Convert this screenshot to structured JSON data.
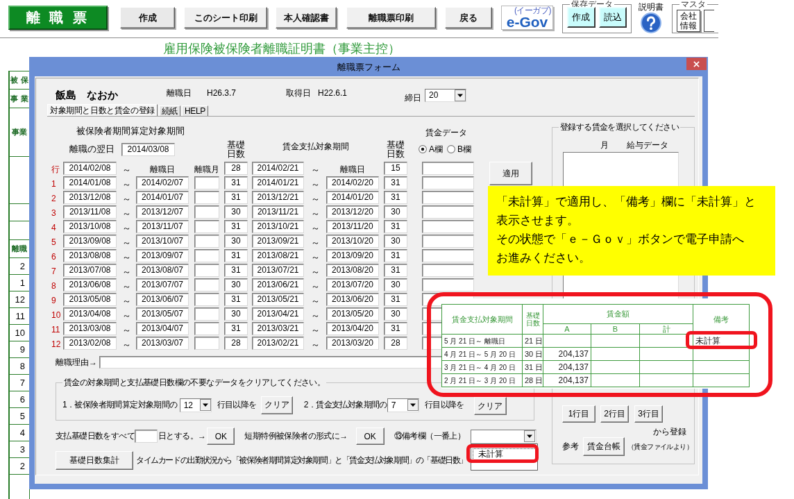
{
  "toolbar": {
    "title_button": "離 職 票",
    "buttons": [
      "作成",
      "このシート印刷",
      "本人確認書",
      "離職票印刷",
      "戻る"
    ],
    "egov": {
      "label": "e-Gov",
      "caption": "(イーガブ)"
    },
    "save_group": {
      "label": "保存データ",
      "buttons": [
        "作成",
        "読込"
      ]
    },
    "manual_label": "説明書",
    "master_group": {
      "label": "マスタ",
      "buttons": [
        "会社情報"
      ]
    }
  },
  "sheet": {
    "title": "雇用保険被保険者離職証明書（事業主控）",
    "side_cells": [
      {
        "kind": "label",
        "text": "被 保"
      },
      {
        "kind": "label",
        "text": "事 業"
      },
      {
        "kind": "label",
        "text": "事業"
      },
      {
        "kind": "blank"
      },
      {
        "kind": "blank"
      },
      {
        "kind": "blank"
      },
      {
        "kind": "label",
        "text": "離職"
      },
      {
        "kind": "month",
        "text": "2"
      },
      {
        "kind": "month",
        "text": "1"
      },
      {
        "kind": "month",
        "text": "12"
      },
      {
        "kind": "month",
        "text": "11"
      },
      {
        "kind": "month",
        "text": "10"
      },
      {
        "kind": "month",
        "text": "9"
      },
      {
        "kind": "month",
        "text": "8"
      },
      {
        "kind": "month",
        "text": "7"
      },
      {
        "kind": "month",
        "text": "6"
      },
      {
        "kind": "month",
        "text": "5"
      },
      {
        "kind": "month",
        "text": "4"
      },
      {
        "kind": "month",
        "text": "3"
      },
      {
        "kind": "month",
        "text": "2"
      },
      {
        "kind": "blank"
      }
    ]
  },
  "dialog": {
    "title": "離職票フォーム",
    "employee": {
      "name": "飯島　なおか",
      "separation_label": "離職日",
      "separation_date": "H26.3.7",
      "acquired_label": "取得日",
      "acquired_date": "H22.6.1",
      "closing_label": "締日",
      "closing_day": "20"
    },
    "tabs": [
      {
        "label": "対象期間と日数と賃金の登録",
        "selected": true
      },
      {
        "label": "続紙",
        "selected": false
      },
      {
        "label": "HELP",
        "selected": false
      }
    ],
    "period_header": {
      "insured_title": "被保険者期間算定対象期間",
      "next_day_label": "離職の翌日",
      "next_day": "2014/03/08",
      "insured_days_label": "基礎日数",
      "wage_title": "賃金支払対象期間",
      "wage_days_label": "基礎日数",
      "wage_data_label": "賃金データ",
      "wage_columns": [
        {
          "label": "A欄",
          "selected": true
        },
        {
          "label": "B欄",
          "selected": false
        }
      ]
    },
    "rows": [
      {
        "no": "行",
        "kind": "first",
        "insured_from": "2014/02/08",
        "sep_a": "～",
        "insured_to": "離職日",
        "month": "離職月",
        "insured_days": "28",
        "wage_from": "2014/02/21",
        "sep_b": "～",
        "wage_to": "離職日",
        "wage_days": "15"
      },
      {
        "no": "1",
        "kind": "period",
        "insured_from": "2014/01/08",
        "sep_a": "～",
        "insured_to": "2014/02/07",
        "insured_days": "31",
        "wage_from": "2014/01/21",
        "sep_b": "～",
        "wage_to": "2014/02/20",
        "wage_days": "31"
      },
      {
        "no": "2",
        "kind": "period",
        "insured_from": "2013/12/08",
        "sep_a": "～",
        "insured_to": "2014/01/07",
        "insured_days": "31",
        "wage_from": "2013/12/21",
        "sep_b": "～",
        "wage_to": "2014/01/20",
        "wage_days": "31"
      },
      {
        "no": "3",
        "kind": "period",
        "insured_from": "2013/11/08",
        "sep_a": "～",
        "insured_to": "2013/12/07",
        "insured_days": "30",
        "wage_from": "2013/11/21",
        "sep_b": "～",
        "wage_to": "2013/12/20",
        "wage_days": "30"
      },
      {
        "no": "4",
        "kind": "period",
        "insured_from": "2013/10/08",
        "sep_a": "～",
        "insured_to": "2013/11/07",
        "insured_days": "31",
        "wage_from": "2013/10/21",
        "sep_b": "～",
        "wage_to": "2013/11/20",
        "wage_days": "31"
      },
      {
        "no": "5",
        "kind": "period",
        "insured_from": "2013/09/08",
        "sep_a": "～",
        "insured_to": "2013/10/07",
        "insured_days": "30",
        "wage_from": "2013/09/21",
        "sep_b": "～",
        "wage_to": "2013/10/20",
        "wage_days": "30"
      },
      {
        "no": "6",
        "kind": "period",
        "insured_from": "2013/08/08",
        "sep_a": "～",
        "insured_to": "2013/09/07",
        "insured_days": "31",
        "wage_from": "2013/08/21",
        "sep_b": "～",
        "wage_to": "2013/09/20",
        "wage_days": "31"
      },
      {
        "no": "7",
        "kind": "period",
        "insured_from": "2013/07/08",
        "sep_a": "～",
        "insured_to": "2013/08/07",
        "insured_days": "31",
        "wage_from": "2013/07/21",
        "sep_b": "～",
        "wage_to": "2013/08/20",
        "wage_days": "31"
      },
      {
        "no": "8",
        "kind": "period",
        "insured_from": "2013/06/08",
        "sep_a": "～",
        "insured_to": "2013/07/07",
        "insured_days": "30",
        "wage_from": "2013/06/21",
        "sep_b": "～",
        "wage_to": "2013/07/20",
        "wage_days": "30"
      },
      {
        "no": "9",
        "kind": "period",
        "insured_from": "2013/05/08",
        "sep_a": "～",
        "insured_to": "2013/06/07",
        "insured_days": "31",
        "wage_from": "2013/05/21",
        "sep_b": "～",
        "wage_to": "2013/06/20",
        "wage_days": "31"
      },
      {
        "no": "10",
        "kind": "period",
        "insured_from": "2013/04/08",
        "sep_a": "～",
        "insured_to": "2013/05/07",
        "insured_days": "30",
        "wage_from": "2013/04/21",
        "sep_b": "～",
        "wage_to": "2013/05/20",
        "wage_days": "30"
      },
      {
        "no": "11",
        "kind": "period",
        "insured_from": "2013/03/08",
        "sep_a": "～",
        "insured_to": "2013/04/07",
        "insured_days": "31",
        "wage_from": "2013/03/21",
        "sep_b": "～",
        "wage_to": "2013/04/20",
        "wage_days": "31"
      },
      {
        "no": "12",
        "kind": "period",
        "insured_from": "2013/02/08",
        "sep_a": "～",
        "insured_to": "2013/03/07",
        "insured_days": "28",
        "wage_from": "2013/02/21",
        "sep_b": "～",
        "wage_to": "2013/03/20",
        "wage_days": "28"
      }
    ],
    "apply_button": "適用",
    "reason_label": "離職理由→",
    "clear_group": {
      "title": "賃金の対象期間と支払基礎日数欄の不要なデータをクリアしてください。",
      "insured_text": "1．被保険者期間算定対象期間の",
      "insured_from": "12",
      "after_text_1": "行目以降を",
      "button_1": "クリア",
      "wage_text": "2．賃金支払対象期間の",
      "wage_from": "7",
      "after_text_2": "行目以降を",
      "button_2": "クリア"
    },
    "days_row": {
      "text_before": "支払基礎日数をすべて",
      "text_after": "日とする。→",
      "ok_1": "OK",
      "short_term_text": "短期特例被保険者の形式に→",
      "ok_2": "OK",
      "remarks_label": "⑬備考欄（一番上）",
      "remarks_options": [
        {
          "label": "未計算",
          "selected": true
        }
      ]
    },
    "tally": {
      "button": "基礎日数集計",
      "text": "タイムカードの出勤状況から「被保険者期間算定対象期間」と「賃金支払対象期間」の「基礎日数」"
    },
    "wage_select": {
      "title": "登録する賃金を選択してください",
      "columns": [
        "月",
        "給与データ"
      ],
      "row_buttons": [
        "1行目",
        "2行目",
        "3行目"
      ],
      "register_text": "から登録",
      "reference_label": "参考",
      "ledger_button": "賃金台帳",
      "ledger_note": "（賃金ファイルより）"
    }
  },
  "note": {
    "lines": [
      "「未計算」で適用し、「備考」欄に「未計算」と",
      "表示させます。",
      "その状態で「ｅ－Ｇｏｖ」ボタンで電子申請へ",
      "お進みください。"
    ]
  },
  "inset_table": {
    "headers": {
      "period": "賃金支払対象期間",
      "days": "基礎日数",
      "amount": "賃金額",
      "a": "A",
      "b": "B",
      "total": "計",
      "remarks": "備考"
    },
    "rows": [
      {
        "period": "5 月 21 日～ 離職日",
        "days": "21 日",
        "remarks": "未計算"
      },
      {
        "period": "4 月 21 日～ 5 月 20 日",
        "days": "30 日",
        "a": "204,137"
      },
      {
        "period": "3 月 21 日～ 4 月 20 日",
        "days": "31 日",
        "a": "204,137"
      },
      {
        "period": "2 月 21 日～ 3 月 20 日",
        "days": "28 日",
        "a": "204,137"
      }
    ]
  }
}
